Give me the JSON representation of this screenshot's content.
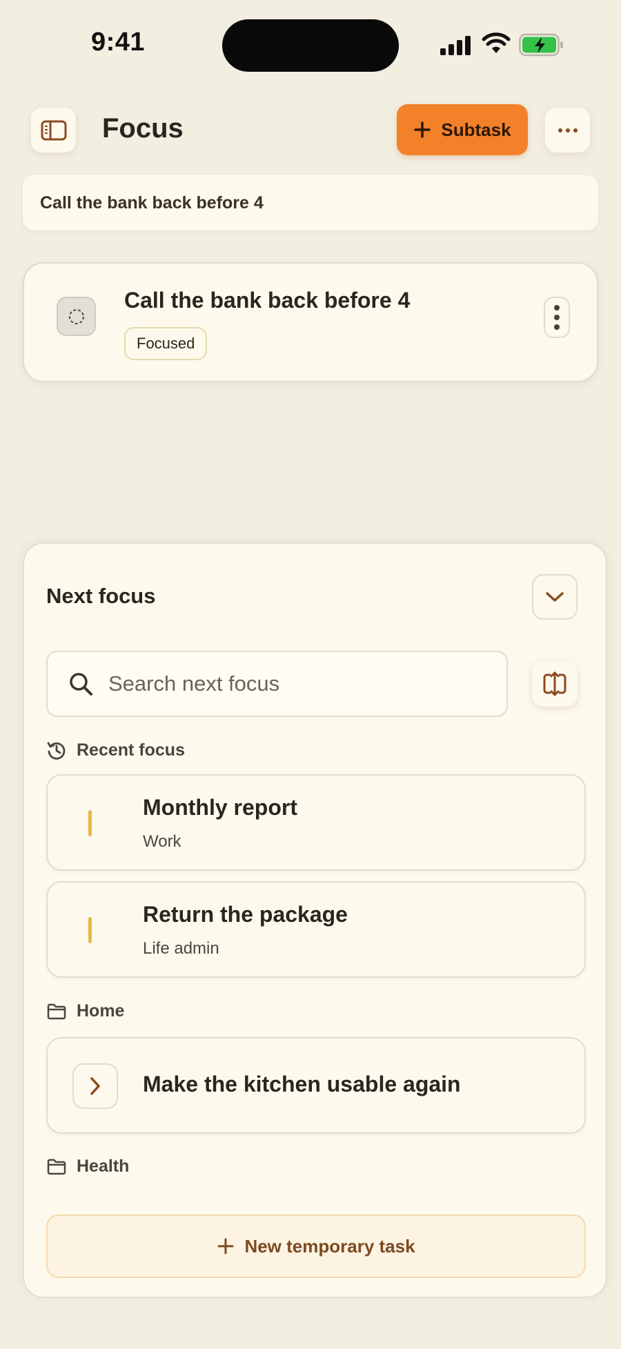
{
  "status_bar": {
    "time": "9:41"
  },
  "header": {
    "title": "Focus",
    "subtask_button_label": "Subtask",
    "sidebar_icon": "sidebar-icon",
    "more_icon": "more-horizontal-icon"
  },
  "breadcrumb": "Call the bank back before 4",
  "focus_card": {
    "title": "Call the bank back before 4",
    "badge": "Focused"
  },
  "next_focus": {
    "title": "Next focus",
    "search": {
      "placeholder": "Search next focus",
      "value": ""
    },
    "recent": {
      "label": "Recent focus",
      "items": [
        {
          "title": "Monthly report",
          "subtitle": "Work"
        },
        {
          "title": "Return the package",
          "subtitle": "Life admin"
        }
      ]
    },
    "groups": [
      {
        "label": "Home",
        "items": [
          {
            "title": "Make the kitchen usable again"
          }
        ]
      },
      {
        "label": "Health",
        "items": []
      }
    ],
    "new_task_label": "New temporary task"
  },
  "colors": {
    "background": "#f2eee0",
    "card": "#fdf9ec",
    "accent": "#f3812a",
    "icon_brown": "#8a4a22",
    "task_marker": "#e6b94a"
  }
}
